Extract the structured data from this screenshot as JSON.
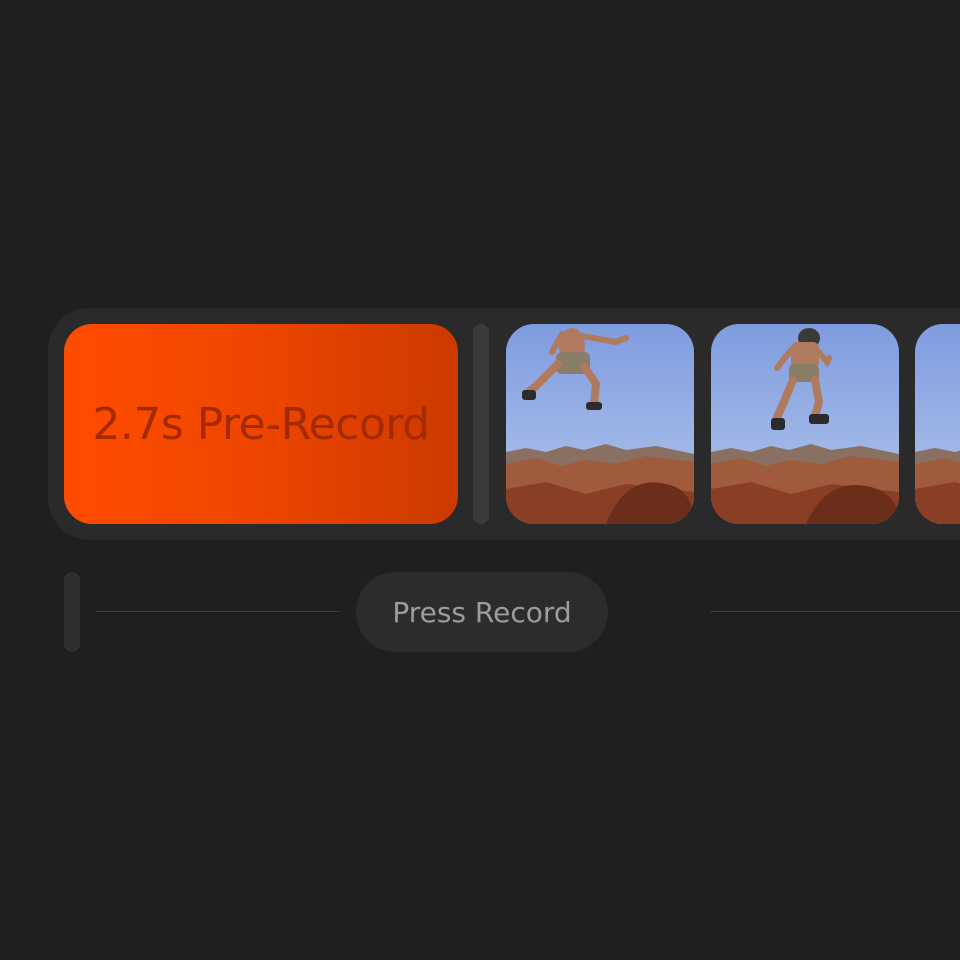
{
  "prerecord": {
    "label": "2.7s Pre-Record",
    "color_start": "#ff4c00",
    "color_end": "#cc3a00"
  },
  "timeline": {
    "frames": [
      {
        "subject": "person-jumping-desert"
      },
      {
        "subject": "person-jumping-desert"
      },
      {
        "subject": "person-jumping-desert"
      }
    ]
  },
  "record_hint": {
    "label": "Press Record"
  },
  "colors": {
    "background": "#1f1f1f",
    "track": "#2a2a2a",
    "accent": "#ff4c00"
  }
}
